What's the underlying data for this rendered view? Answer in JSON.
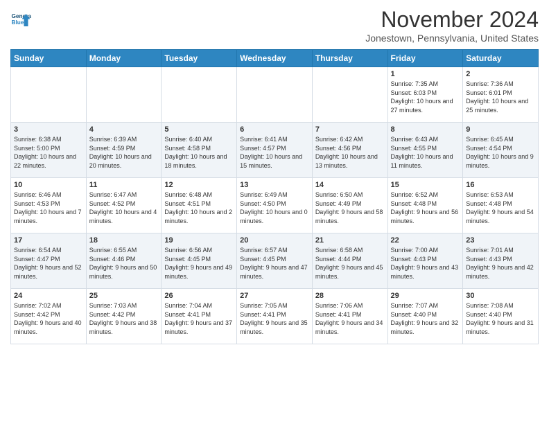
{
  "header": {
    "logo_line1": "General",
    "logo_line2": "Blue",
    "title": "November 2024",
    "subtitle": "Jonestown, Pennsylvania, United States"
  },
  "weekdays": [
    "Sunday",
    "Monday",
    "Tuesday",
    "Wednesday",
    "Thursday",
    "Friday",
    "Saturday"
  ],
  "weeks": [
    [
      {
        "day": "",
        "info": ""
      },
      {
        "day": "",
        "info": ""
      },
      {
        "day": "",
        "info": ""
      },
      {
        "day": "",
        "info": ""
      },
      {
        "day": "",
        "info": ""
      },
      {
        "day": "1",
        "info": "Sunrise: 7:35 AM\nSunset: 6:03 PM\nDaylight: 10 hours\nand 27 minutes."
      },
      {
        "day": "2",
        "info": "Sunrise: 7:36 AM\nSunset: 6:01 PM\nDaylight: 10 hours\nand 25 minutes."
      }
    ],
    [
      {
        "day": "3",
        "info": "Sunrise: 6:38 AM\nSunset: 5:00 PM\nDaylight: 10 hours\nand 22 minutes."
      },
      {
        "day": "4",
        "info": "Sunrise: 6:39 AM\nSunset: 4:59 PM\nDaylight: 10 hours\nand 20 minutes."
      },
      {
        "day": "5",
        "info": "Sunrise: 6:40 AM\nSunset: 4:58 PM\nDaylight: 10 hours\nand 18 minutes."
      },
      {
        "day": "6",
        "info": "Sunrise: 6:41 AM\nSunset: 4:57 PM\nDaylight: 10 hours\nand 15 minutes."
      },
      {
        "day": "7",
        "info": "Sunrise: 6:42 AM\nSunset: 4:56 PM\nDaylight: 10 hours\nand 13 minutes."
      },
      {
        "day": "8",
        "info": "Sunrise: 6:43 AM\nSunset: 4:55 PM\nDaylight: 10 hours\nand 11 minutes."
      },
      {
        "day": "9",
        "info": "Sunrise: 6:45 AM\nSunset: 4:54 PM\nDaylight: 10 hours\nand 9 minutes."
      }
    ],
    [
      {
        "day": "10",
        "info": "Sunrise: 6:46 AM\nSunset: 4:53 PM\nDaylight: 10 hours\nand 7 minutes."
      },
      {
        "day": "11",
        "info": "Sunrise: 6:47 AM\nSunset: 4:52 PM\nDaylight: 10 hours\nand 4 minutes."
      },
      {
        "day": "12",
        "info": "Sunrise: 6:48 AM\nSunset: 4:51 PM\nDaylight: 10 hours\nand 2 minutes."
      },
      {
        "day": "13",
        "info": "Sunrise: 6:49 AM\nSunset: 4:50 PM\nDaylight: 10 hours\nand 0 minutes."
      },
      {
        "day": "14",
        "info": "Sunrise: 6:50 AM\nSunset: 4:49 PM\nDaylight: 9 hours\nand 58 minutes."
      },
      {
        "day": "15",
        "info": "Sunrise: 6:52 AM\nSunset: 4:48 PM\nDaylight: 9 hours\nand 56 minutes."
      },
      {
        "day": "16",
        "info": "Sunrise: 6:53 AM\nSunset: 4:48 PM\nDaylight: 9 hours\nand 54 minutes."
      }
    ],
    [
      {
        "day": "17",
        "info": "Sunrise: 6:54 AM\nSunset: 4:47 PM\nDaylight: 9 hours\nand 52 minutes."
      },
      {
        "day": "18",
        "info": "Sunrise: 6:55 AM\nSunset: 4:46 PM\nDaylight: 9 hours\nand 50 minutes."
      },
      {
        "day": "19",
        "info": "Sunrise: 6:56 AM\nSunset: 4:45 PM\nDaylight: 9 hours\nand 49 minutes."
      },
      {
        "day": "20",
        "info": "Sunrise: 6:57 AM\nSunset: 4:45 PM\nDaylight: 9 hours\nand 47 minutes."
      },
      {
        "day": "21",
        "info": "Sunrise: 6:58 AM\nSunset: 4:44 PM\nDaylight: 9 hours\nand 45 minutes."
      },
      {
        "day": "22",
        "info": "Sunrise: 7:00 AM\nSunset: 4:43 PM\nDaylight: 9 hours\nand 43 minutes."
      },
      {
        "day": "23",
        "info": "Sunrise: 7:01 AM\nSunset: 4:43 PM\nDaylight: 9 hours\nand 42 minutes."
      }
    ],
    [
      {
        "day": "24",
        "info": "Sunrise: 7:02 AM\nSunset: 4:42 PM\nDaylight: 9 hours\nand 40 minutes."
      },
      {
        "day": "25",
        "info": "Sunrise: 7:03 AM\nSunset: 4:42 PM\nDaylight: 9 hours\nand 38 minutes."
      },
      {
        "day": "26",
        "info": "Sunrise: 7:04 AM\nSunset: 4:41 PM\nDaylight: 9 hours\nand 37 minutes."
      },
      {
        "day": "27",
        "info": "Sunrise: 7:05 AM\nSunset: 4:41 PM\nDaylight: 9 hours\nand 35 minutes."
      },
      {
        "day": "28",
        "info": "Sunrise: 7:06 AM\nSunset: 4:41 PM\nDaylight: 9 hours\nand 34 minutes."
      },
      {
        "day": "29",
        "info": "Sunrise: 7:07 AM\nSunset: 4:40 PM\nDaylight: 9 hours\nand 32 minutes."
      },
      {
        "day": "30",
        "info": "Sunrise: 7:08 AM\nSunset: 4:40 PM\nDaylight: 9 hours\nand 31 minutes."
      }
    ]
  ]
}
